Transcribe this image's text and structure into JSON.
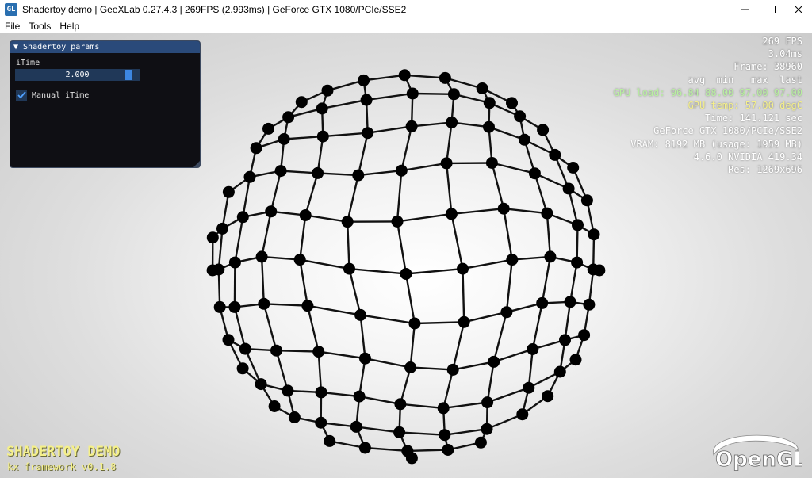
{
  "window": {
    "icon_text": "GL",
    "title": "Shadertoy demo | GeeXLab 0.27.4.3 | 269FPS (2.993ms) | GeForce GTX 1080/PCIe/SSE2"
  },
  "menu": {
    "items": [
      "File",
      "Tools",
      "Help"
    ]
  },
  "panel": {
    "title": "▼ Shadertoy params",
    "slider_label": "iTime",
    "slider_value": "2.000",
    "slider_fraction": 0.93,
    "checkbox_label": "Manual iTime",
    "checkbox_checked": true
  },
  "stats": [
    {
      "text": "269 FPS",
      "color": "#ffffff"
    },
    {
      "text": "3.04ms",
      "color": "#ffffff"
    },
    {
      "text": "Frame: 38960",
      "color": "#ffffff"
    },
    {
      "text": "avg  min   max  last",
      "color": "#ffffff"
    },
    {
      "text": "GPU load: 96.84 88.00 97.00 97.00",
      "color": "#b8f0a0"
    },
    {
      "text": "GPU temp: 57.00 degC",
      "color": "#f5f08a"
    },
    {
      "text": "Time: 141.121 sec",
      "color": "#ffffff"
    },
    {
      "text": "GeForce GTX 1080/PCIe/SSE2",
      "color": "#ffffff"
    },
    {
      "text": "VRAM: 8192 MB (usage: 1959 MB)",
      "color": "#ffffff"
    },
    {
      "text": "4.6.0 NVIDIA 419.34",
      "color": "#ffffff"
    },
    {
      "text": "Res: 1269x696",
      "color": "#ffffff"
    }
  ],
  "branding": {
    "title": "SHADERTOY DEMO",
    "subtitle": "kx framework v0.1.8",
    "logo_text": "OpenGL"
  }
}
